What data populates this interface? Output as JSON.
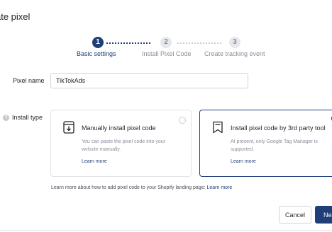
{
  "dialog": {
    "title": "ate pixel"
  },
  "stepper": {
    "steps": [
      {
        "number": "1",
        "label": "Basic settings"
      },
      {
        "number": "2",
        "label": "Install Pixel Code"
      },
      {
        "number": "3",
        "label": "Create tracking event"
      }
    ]
  },
  "form": {
    "pixel_name_label": "Pixel name",
    "pixel_name_value": "TikTokAds",
    "install_type_label": "Install type"
  },
  "options": [
    {
      "icon": "download-box-icon",
      "title": "Manually install pixel code",
      "description": "You can paste the pixel code into your website manually.",
      "link": "Learn more",
      "selected": false
    },
    {
      "icon": "bookmark-icon",
      "title": "Install pixel code by 3rd party tool",
      "description": "At present, only Google Tag Manager is supported.",
      "link": "Learn more",
      "selected": true
    }
  ],
  "hint": {
    "text": "Learn more about how to add pixel code to your Shopify landing page: ",
    "link": "Learn more"
  },
  "footer": {
    "cancel_label": "Cancel",
    "next_label": "Next"
  },
  "colors": {
    "accent": "#203e78",
    "border": "#e1e3e7",
    "muted": "#8a8f99"
  }
}
